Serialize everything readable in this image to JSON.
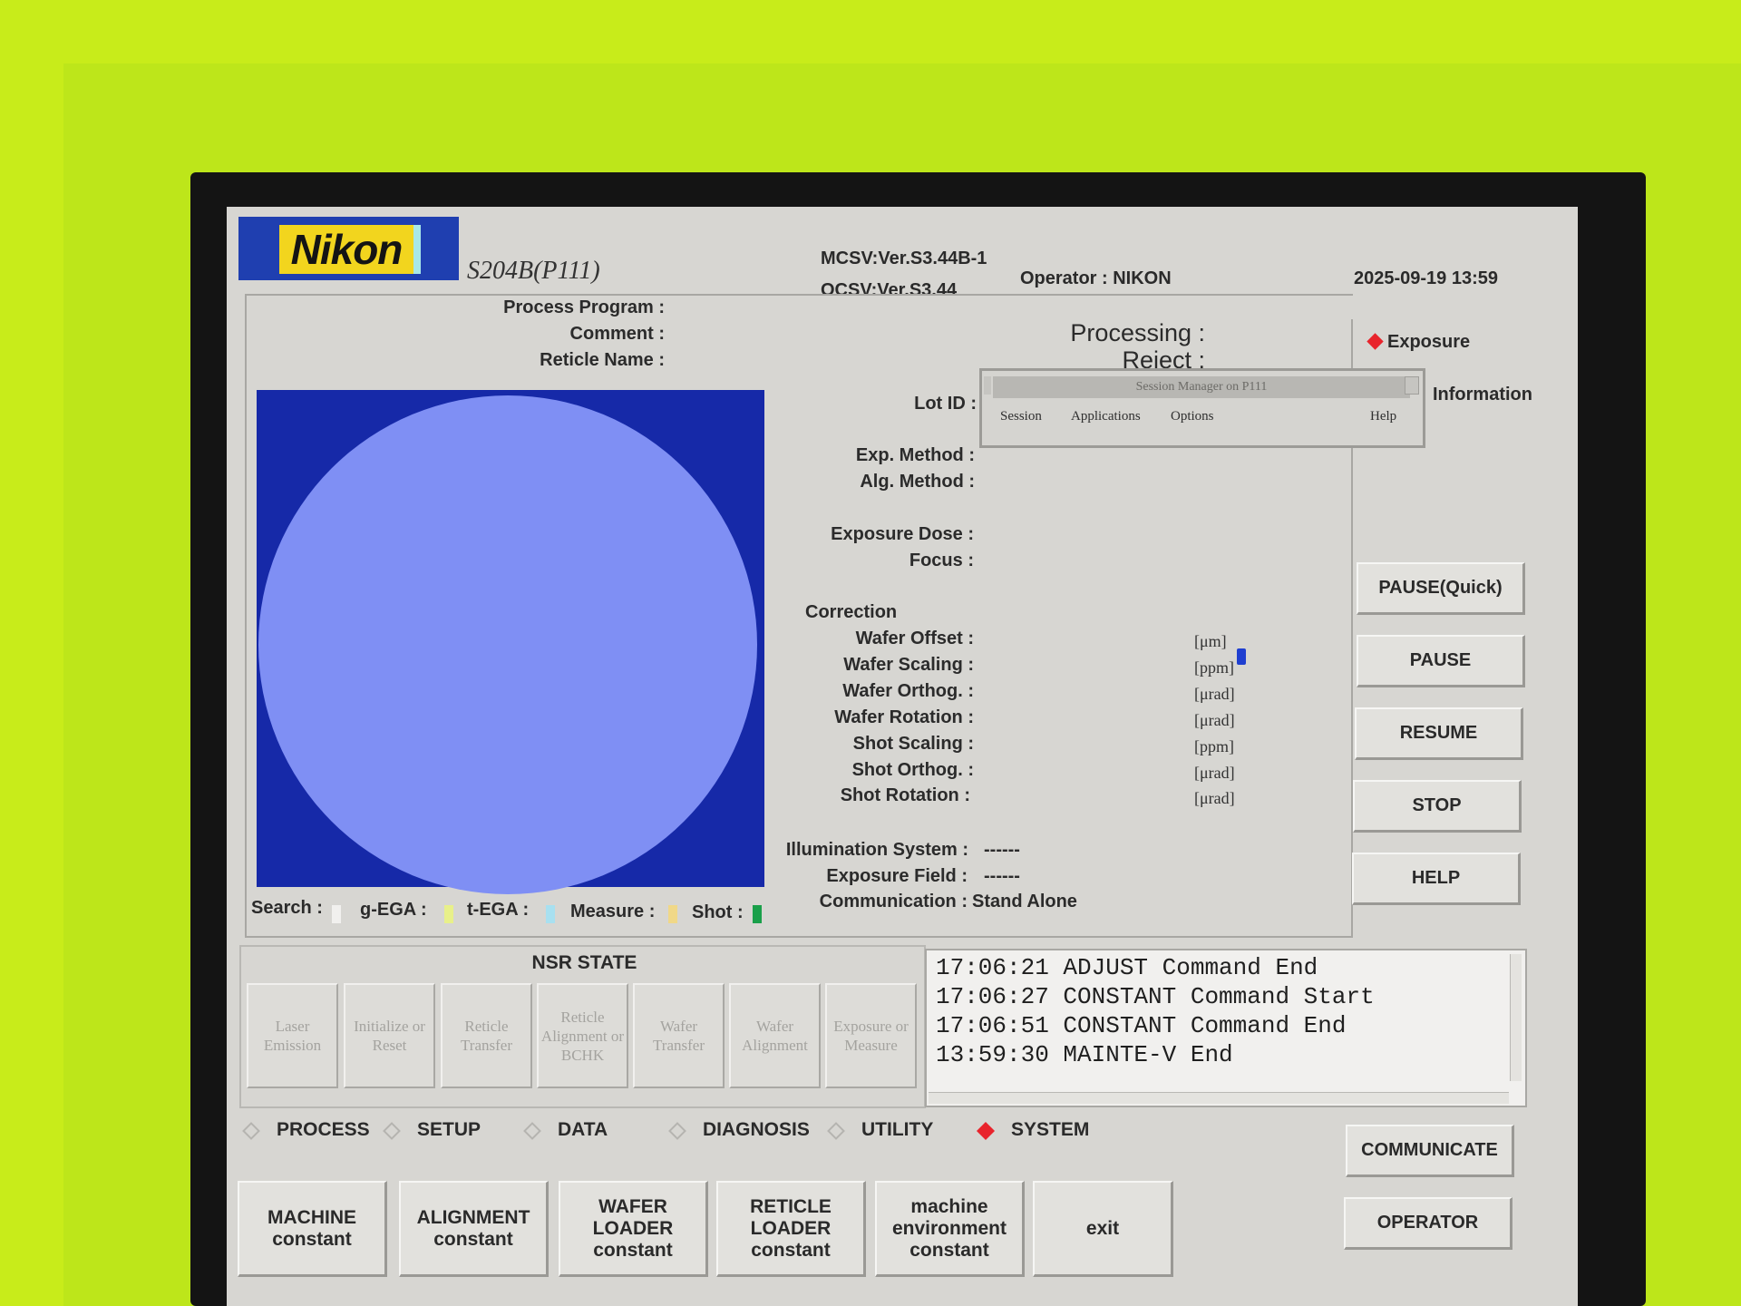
{
  "header": {
    "logo": "Nikon",
    "model": "S204B(P111)",
    "mcsv": "MCSV:Ver.S3.44B-1",
    "ocsv": "OCSV:Ver.S3.44",
    "operator": "Operator : NIKON",
    "datetime": "2025-09-19 13:59"
  },
  "info_top": {
    "process_program": "Process Program :",
    "comment": "Comment :",
    "reticle_name": "Reticle Name :",
    "processing": "Processing :",
    "reject": "Reject :",
    "lot_id": "Lot ID :"
  },
  "side_radio": {
    "exposure": "Exposure",
    "information": "Information"
  },
  "session_manager": {
    "title": "Session Manager on P111",
    "menus": [
      "Session",
      "Applications",
      "Options",
      "Help"
    ]
  },
  "params": {
    "exp_method": "Exp. Method :",
    "alg_method": "Alg. Method :",
    "exposure_dose": "Exposure Dose :",
    "focus": "Focus :",
    "correction": "Correction"
  },
  "corrections": [
    {
      "label": "Wafer Offset :",
      "unit": "[μm]"
    },
    {
      "label": "Wafer Scaling :",
      "unit": "[ppm]"
    },
    {
      "label": "Wafer Orthog. :",
      "unit": "[μrad]"
    },
    {
      "label": "Wafer Rotation :",
      "unit": "[μrad]"
    },
    {
      "label": "Shot Scaling :",
      "unit": "[ppm]"
    },
    {
      "label": "Shot Orthog. :",
      "unit": "[μrad]"
    },
    {
      "label": "Shot Rotation :",
      "unit": "[μrad]"
    }
  ],
  "system_info": {
    "illumination_label": "Illumination System :",
    "illumination_value": "------",
    "exposure_field_label": "Exposure Field :",
    "exposure_field_value": "------",
    "communication_label": "Communication :",
    "communication_value": "Stand Alone"
  },
  "legend": {
    "search": "Search :",
    "g_ega": "g-EGA :",
    "t_ega": "t-EGA :",
    "measure": "Measure :",
    "shot": "Shot :",
    "colors": {
      "search": "#f1f0ee",
      "g_ega": "#e8f08a",
      "t_ega": "#a8e0f0",
      "measure": "#f0d888",
      "shot": "#1aa04a"
    }
  },
  "right_buttons": [
    "PAUSE(Quick)",
    "PAUSE",
    "RESUME",
    "STOP",
    "HELP"
  ],
  "nsr_state": {
    "title": "NSR STATE",
    "buttons": [
      "Laser Emission",
      "Initialize or Reset",
      "Reticle Transfer",
      "Reticle Alignment or BCHK",
      "Wafer Transfer",
      "Wafer Alignment",
      "Exposure or Measure"
    ]
  },
  "log": [
    "17:06:21 ADJUST Command End",
    "17:06:27 CONSTANT Command Start",
    "17:06:51 CONSTANT Command End",
    "13:59:30 MAINTE-V End"
  ],
  "tabs": [
    {
      "label": "PROCESS",
      "selected": false
    },
    {
      "label": "SETUP",
      "selected": false
    },
    {
      "label": "DATA",
      "selected": false
    },
    {
      "label": "DIAGNOSIS",
      "selected": false
    },
    {
      "label": "UTILITY",
      "selected": false
    },
    {
      "label": "SYSTEM",
      "selected": true
    }
  ],
  "bottom_buttons": [
    "MACHINE constant",
    "ALIGNMENT constant",
    "WAFER LOADER constant",
    "RETICLE LOADER constant",
    "machine environment constant",
    "exit"
  ],
  "side_bottom_buttons": [
    "COMMUNICATE",
    "OPERATOR"
  ],
  "colors": {
    "wafer_bg": "#1629a8",
    "wafer": "#7f8ff4",
    "selected_indicator": "#e8242c"
  }
}
